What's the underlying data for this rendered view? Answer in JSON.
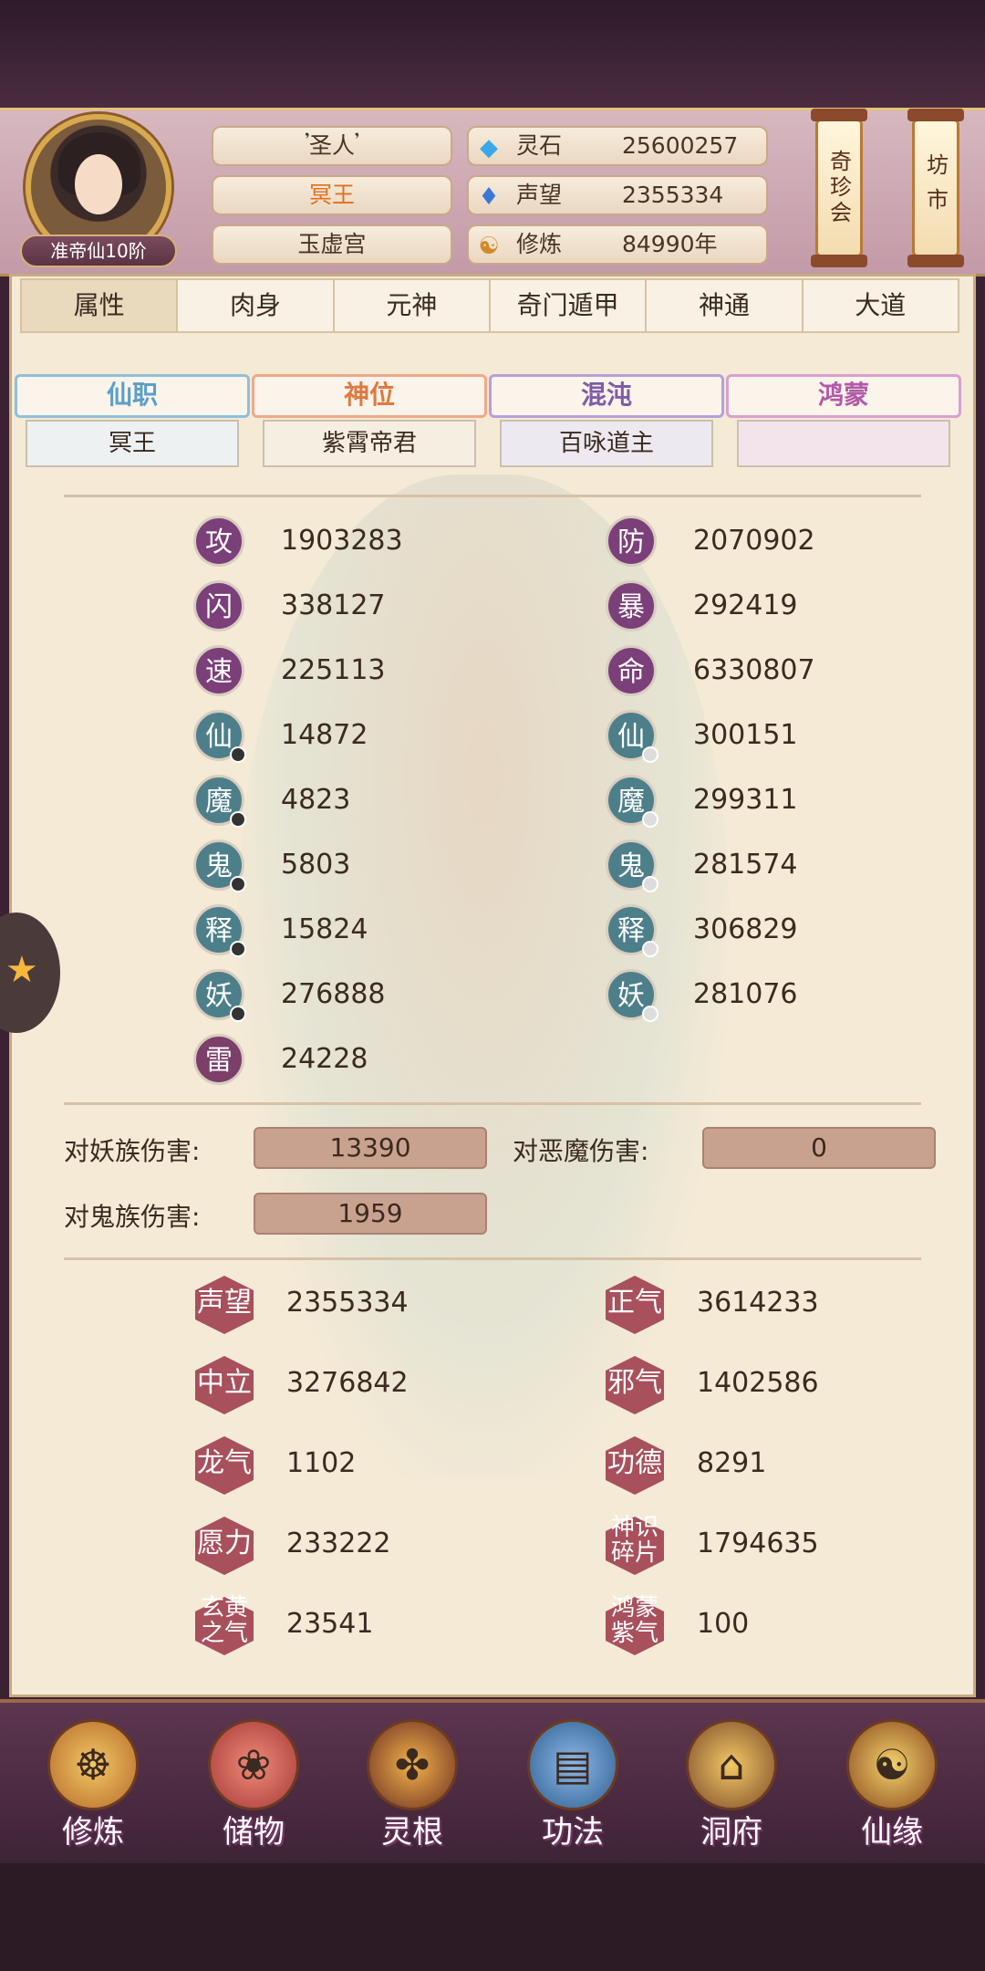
{
  "header": {
    "rank_badge": "准帝仙10阶",
    "title": "𝄒圣人𝄒",
    "position": "冥王",
    "sect": "玉虚宫",
    "resources": [
      {
        "icon": "spirit-stone-icon",
        "label": "灵石",
        "value": "25600257"
      },
      {
        "icon": "prestige-icon",
        "label": "声望",
        "value": "2355334"
      },
      {
        "icon": "cultivation-icon",
        "label": "修炼",
        "value": "84990年"
      }
    ],
    "banners": [
      "奇珍会",
      "坊市"
    ]
  },
  "tabs": [
    "属性",
    "肉身",
    "元神",
    "奇门遁甲",
    "神通",
    "大道"
  ],
  "categories": [
    {
      "title": "仙职",
      "value": "冥王",
      "color": "#5aa0c8"
    },
    {
      "title": "神位",
      "value": "紫霄帝君",
      "color": "#e07840"
    },
    {
      "title": "混沌",
      "value": "百咏道主",
      "color": "#7f5ba8"
    },
    {
      "title": "鸿蒙",
      "value": "",
      "color": "#b15aa8"
    }
  ],
  "stats_left": [
    {
      "badge": "攻",
      "value": "1903283"
    },
    {
      "badge": "闪",
      "value": "338127"
    },
    {
      "badge": "速",
      "value": "225113"
    },
    {
      "badge": "仙",
      "value": "14872"
    },
    {
      "badge": "魔",
      "value": "4823"
    },
    {
      "badge": "鬼",
      "value": "5803"
    },
    {
      "badge": "释",
      "value": "15824"
    },
    {
      "badge": "妖",
      "value": "276888"
    },
    {
      "badge": "雷",
      "value": "24228"
    }
  ],
  "stats_right": [
    {
      "badge": "防",
      "value": "2070902"
    },
    {
      "badge": "暴",
      "value": "292419"
    },
    {
      "badge": "命",
      "value": "6330807"
    },
    {
      "badge": "仙",
      "value": "300151"
    },
    {
      "badge": "魔",
      "value": "299311"
    },
    {
      "badge": "鬼",
      "value": "281574"
    },
    {
      "badge": "释",
      "value": "306829"
    },
    {
      "badge": "妖",
      "value": "281076"
    }
  ],
  "damage": [
    {
      "label": "对妖族伤害:",
      "value": "13390"
    },
    {
      "label": "对恶魔伤害:",
      "value": "0"
    },
    {
      "label": "对鬼族伤害:",
      "value": "1959"
    }
  ],
  "attributes_left": [
    {
      "label": "声望",
      "value": "2355334"
    },
    {
      "label": "中立",
      "value": "3276842"
    },
    {
      "label": "龙气",
      "value": "1102"
    },
    {
      "label": "愿力",
      "value": "233222"
    },
    {
      "label": "玄黄之气",
      "value": "23541"
    }
  ],
  "attributes_right": [
    {
      "label": "正气",
      "value": "3614233"
    },
    {
      "label": "邪气",
      "value": "1402586"
    },
    {
      "label": "功德",
      "value": "8291"
    },
    {
      "label": "神识碎片",
      "value": "1794635"
    },
    {
      "label": "鸿蒙紫气",
      "value": "100"
    }
  ],
  "nav": [
    {
      "label": "修炼",
      "icon": "cultivate-icon"
    },
    {
      "label": "储物",
      "icon": "storage-bag-icon"
    },
    {
      "label": "灵根",
      "icon": "spirit-root-icon"
    },
    {
      "label": "功法",
      "icon": "technique-book-icon"
    },
    {
      "label": "洞府",
      "icon": "cave-palace-icon"
    },
    {
      "label": "仙缘",
      "icon": "gourd-icon"
    }
  ]
}
